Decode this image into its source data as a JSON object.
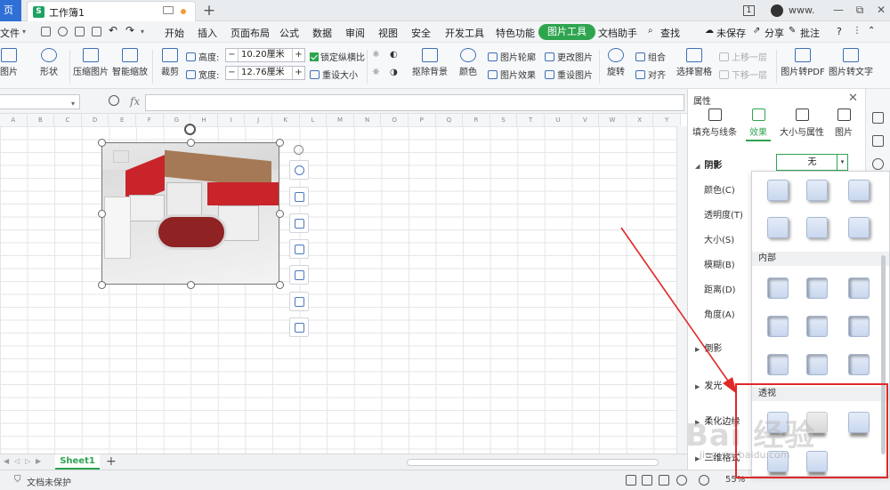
{
  "titlebar": {
    "home_tab": "页",
    "doc_title": "工作簿1",
    "doc_icon_letter": "S",
    "badge": "1",
    "user": "www.",
    "win_min": "—",
    "win_restore": "⧉",
    "win_close": "✕"
  },
  "menu": {
    "file": "文件",
    "items": [
      "开始",
      "插入",
      "页面布局",
      "公式",
      "数据",
      "审阅",
      "视图",
      "安全",
      "开发工具",
      "特色功能"
    ],
    "active": "图片工具",
    "after": [
      "文档助手"
    ],
    "search": "查找",
    "unsaved": "未保存",
    "share": "分享",
    "comment": "批注",
    "help": "?"
  },
  "ribbon": {
    "picture": "图片",
    "shape": "形状",
    "compress": "压缩图片",
    "smart_zoom": "智能缩放",
    "crop": "裁剪",
    "height_label": "高度:",
    "height_value": "10.20厘米",
    "width_label": "宽度:",
    "width_value": "12.76厘米",
    "lock_ratio": "锁定纵横比",
    "reset_size": "重设大小",
    "remove_bg": "抠除背景",
    "color": "颜色",
    "outline": "图片轮廓",
    "effect": "图片效果",
    "change_pic": "更改图片",
    "reset_pic": "重设图片",
    "rotate": "旋转",
    "group": "组合",
    "align": "对齐",
    "select_pane": "选择窗格",
    "bring_up": "上移一层",
    "send_down": "下移一层",
    "to_pdf": "图片转PDF",
    "to_text": "图片转文字"
  },
  "formula": {
    "fx": "fx"
  },
  "columns": [
    "A",
    "B",
    "C",
    "D",
    "E",
    "F",
    "G",
    "H",
    "I",
    "J",
    "K",
    "L",
    "M",
    "N",
    "O",
    "P",
    "Q",
    "R",
    "S",
    "T",
    "U",
    "V",
    "W",
    "X",
    "Y"
  ],
  "sheet_tab": "Sheet1",
  "add_sheet": "+",
  "status": {
    "protect": "文档未保护",
    "zoom": "55%"
  },
  "pane": {
    "title": "属性",
    "close": "✕",
    "tabs": [
      "填充与线条",
      "效果",
      "大小与属性",
      "图片"
    ],
    "active_tab_index": 1,
    "shadow_label": "阴影",
    "shadow_value": "无",
    "props": [
      "颜色(C)",
      "透明度(T)",
      "大小(S)",
      "模糊(B)",
      "距离(D)",
      "角度(A)"
    ],
    "sections": [
      "倒影",
      "发光",
      "柔化边缘",
      "三维格式"
    ]
  },
  "dropdown": {
    "group_inner": "内部",
    "group_perspective": "透视"
  },
  "watermark": {
    "text": "Bai 经验",
    "url": "jingyan.baidu.com"
  },
  "colors": {
    "accent_green": "#2ea44f",
    "annotation_red": "#e02929",
    "home_blue": "#2f6fd6"
  }
}
